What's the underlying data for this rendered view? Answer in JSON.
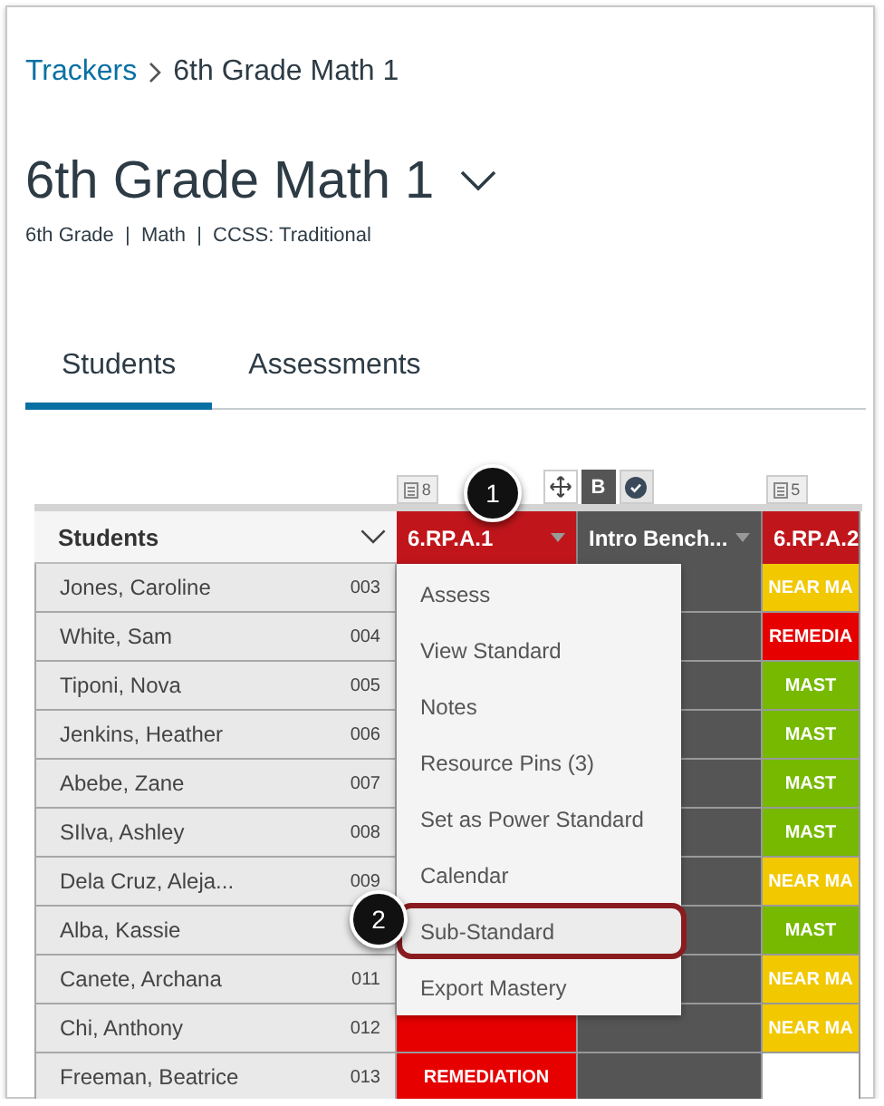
{
  "breadcrumb": {
    "link": "Trackers",
    "current": "6th Grade Math 1"
  },
  "title": "6th Grade Math 1",
  "subtitle": "6th Grade  |  Math  |  CCSS: Traditional",
  "tabs": [
    {
      "label": "Students",
      "selected": true
    },
    {
      "label": "Assessments",
      "selected": false
    }
  ],
  "grid": {
    "students_header": "Students",
    "columns": [
      {
        "label": "6.RP.A.1",
        "kind": "standard",
        "toolbar": {
          "kind": "count",
          "count": "8"
        }
      },
      {
        "label": "Intro Bench...",
        "kind": "benchmark",
        "toolbar": {
          "kind": "tools",
          "label": "B"
        }
      },
      {
        "label": "6.RP.A.2",
        "kind": "standard",
        "toolbar": {
          "kind": "count",
          "count": "5"
        }
      }
    ],
    "rows": [
      {
        "name": "Jones, Caroline",
        "number": "003",
        "cells": [
          {},
          {
            "kind": "blank"
          },
          {
            "kind": "near",
            "label": "NEAR MA"
          }
        ]
      },
      {
        "name": "White, Sam",
        "number": "004",
        "cells": [
          {},
          {
            "kind": "blank"
          },
          {
            "kind": "remediation",
            "label": "REMEDIA"
          }
        ]
      },
      {
        "name": "Tiponi, Nova",
        "number": "005",
        "cells": [
          {},
          {
            "kind": "blank"
          },
          {
            "kind": "mastery",
            "label": "MAST"
          }
        ]
      },
      {
        "name": "Jenkins, Heather",
        "number": "006",
        "cells": [
          {},
          {
            "kind": "blank"
          },
          {
            "kind": "mastery",
            "label": "MAST"
          }
        ]
      },
      {
        "name": "Abebe, Zane",
        "number": "007",
        "cells": [
          {},
          {
            "kind": "blank"
          },
          {
            "kind": "mastery",
            "label": "MAST"
          }
        ]
      },
      {
        "name": "SIlva, Ashley",
        "number": "008",
        "cells": [
          {},
          {
            "kind": "blank"
          },
          {
            "kind": "mastery",
            "label": "MAST"
          }
        ]
      },
      {
        "name": "Dela Cruz, Aleja...",
        "number": "009",
        "cells": [
          {},
          {
            "kind": "blank"
          },
          {
            "kind": "near",
            "label": "NEAR MA"
          }
        ]
      },
      {
        "name": "Alba, Kassie",
        "cells": [
          {},
          {
            "kind": "blank"
          },
          {
            "kind": "mastery",
            "label": "MAST"
          }
        ]
      },
      {
        "name": "Canete, Archana",
        "number": "011",
        "cells": [
          {},
          {
            "kind": "blank"
          },
          {
            "kind": "near",
            "label": "NEAR MA"
          }
        ]
      },
      {
        "name": "Chi, Anthony",
        "number": "012",
        "cells": [
          {
            "kind": "remediation"
          },
          {
            "kind": "blank"
          },
          {
            "kind": "near",
            "label": "NEAR MA"
          }
        ]
      },
      {
        "name": "Freeman, Beatrice",
        "number": "013",
        "cells": [
          {
            "kind": "remediation",
            "label": "REMEDIATION"
          },
          {
            "kind": "blank"
          },
          {
            "kind": "empty"
          }
        ]
      }
    ]
  },
  "menu": {
    "items": [
      {
        "label": "Assess",
        "selected": false
      },
      {
        "label": "View Standard",
        "selected": false
      },
      {
        "label": "Notes",
        "selected": false
      },
      {
        "label": "Resource Pins (3)",
        "selected": false
      },
      {
        "label": "Set as Power Standard",
        "selected": false
      },
      {
        "label": "Calendar",
        "selected": false
      },
      {
        "label": "Sub-Standard",
        "selected": true
      },
      {
        "label": "Export Mastery",
        "selected": false
      }
    ]
  },
  "callouts": [
    "1",
    "2"
  ]
}
